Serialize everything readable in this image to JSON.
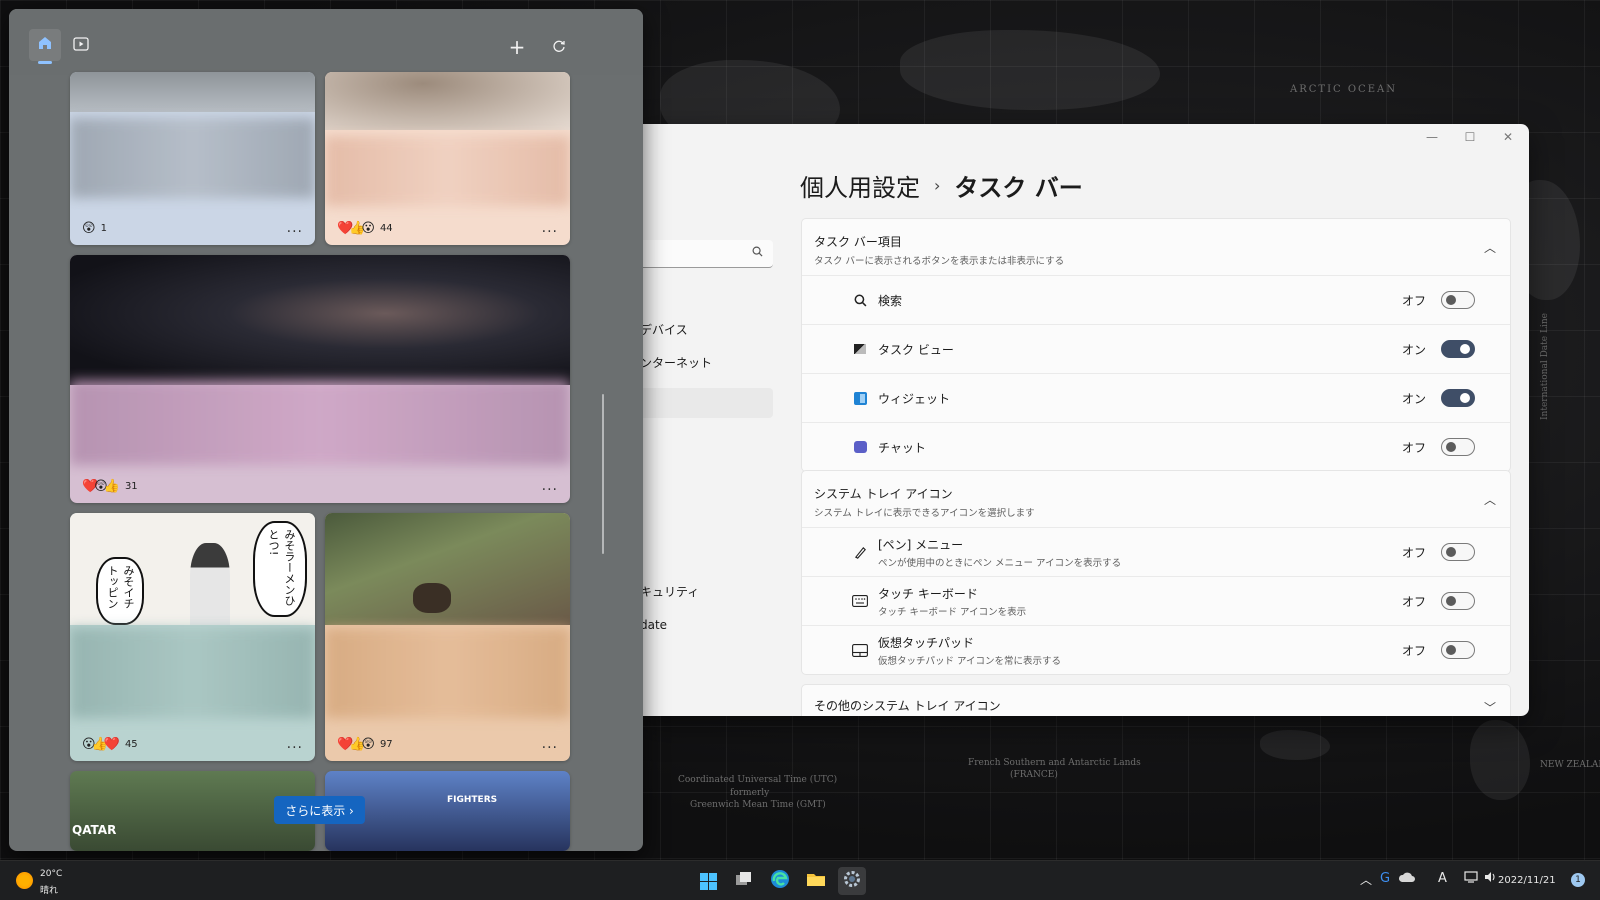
{
  "widgets": {
    "tabs": {
      "home_icon": "home-icon",
      "video_icon": "video-icon"
    },
    "actions": {
      "add_icon": "plus-icon",
      "refresh_icon": "refresh-icon"
    },
    "cards": [
      {
        "reactions": "😲",
        "count": "1",
        "more": "..."
      },
      {
        "reactions": "❤️👍😮",
        "count": "44",
        "more": "..."
      },
      {
        "reactions": "❤️😲👍",
        "count": "31",
        "more": "..."
      },
      {
        "reactions": "😮👍❤️",
        "count": "45",
        "more": "...",
        "manga_text": "みそラーメンひとつ!",
        "manga_text_2": "みそイチトッピン"
      },
      {
        "reactions": "❤️👍😲",
        "count": "97",
        "more": "..."
      }
    ],
    "show_more": "さらに表示 ›",
    "bottom_card_text": "FIGHTERS",
    "bottom_card_text_2": "QATAR"
  },
  "settings": {
    "window": {
      "minimize": "—",
      "maximize": "☐",
      "close": "✕"
    },
    "sidebar": {
      "items": [
        "デバイス",
        "ンターネット",
        "キュリティ",
        "date"
      ]
    },
    "breadcrumb": {
      "parent": "個人用設定",
      "separator": "›",
      "current": "タスク バー"
    },
    "taskbar_items": {
      "title": "タスク バー項目",
      "subtitle": "タスク バーに表示されるボタンを表示または非表示にする",
      "rows": [
        {
          "label": "検索",
          "state": "オフ",
          "on": false,
          "icon": "search-icon"
        },
        {
          "label": "タスク ビュー",
          "state": "オン",
          "on": true,
          "icon": "task-view-icon"
        },
        {
          "label": "ウィジェット",
          "state": "オン",
          "on": true,
          "icon": "widgets-icon"
        },
        {
          "label": "チャット",
          "state": "オフ",
          "on": false,
          "icon": "chat-icon"
        }
      ]
    },
    "tray_icons": {
      "title": "システム トレイ アイコン",
      "subtitle": "システム トレイに表示できるアイコンを選択します",
      "rows": [
        {
          "label": "[ペン] メニュー",
          "sub": "ペンが使用中のときにペン メニュー アイコンを表示する",
          "state": "オフ",
          "on": false,
          "icon": "pen-icon"
        },
        {
          "label": "タッチ キーボード",
          "sub": "タッチ キーボード アイコンを表示",
          "state": "オフ",
          "on": false,
          "icon": "keyboard-icon"
        },
        {
          "label": "仮想タッチパッド",
          "sub": "仮想タッチパッド アイコンを常に表示する",
          "state": "オフ",
          "on": false,
          "icon": "touchpad-icon"
        }
      ]
    },
    "other_tray": {
      "title": "その他のシステム トレイ アイコン"
    }
  },
  "wallpaper": {
    "labels": [
      "Coordinated Universal Time (UTC)",
      "formerly",
      "Greenwich Mean Time (GMT)",
      "French Southern and Antarctic Lands",
      "(FRANCE)",
      "ARCTIC OCEAN",
      "International Date Line",
      "NEW ZEALAND"
    ]
  },
  "taskbar": {
    "weather": {
      "temp": "20°C",
      "condition": "晴れ"
    },
    "clock": "2022/11/21",
    "tray": {
      "chevron": "︿",
      "ime": "A",
      "notifications": "1"
    }
  }
}
